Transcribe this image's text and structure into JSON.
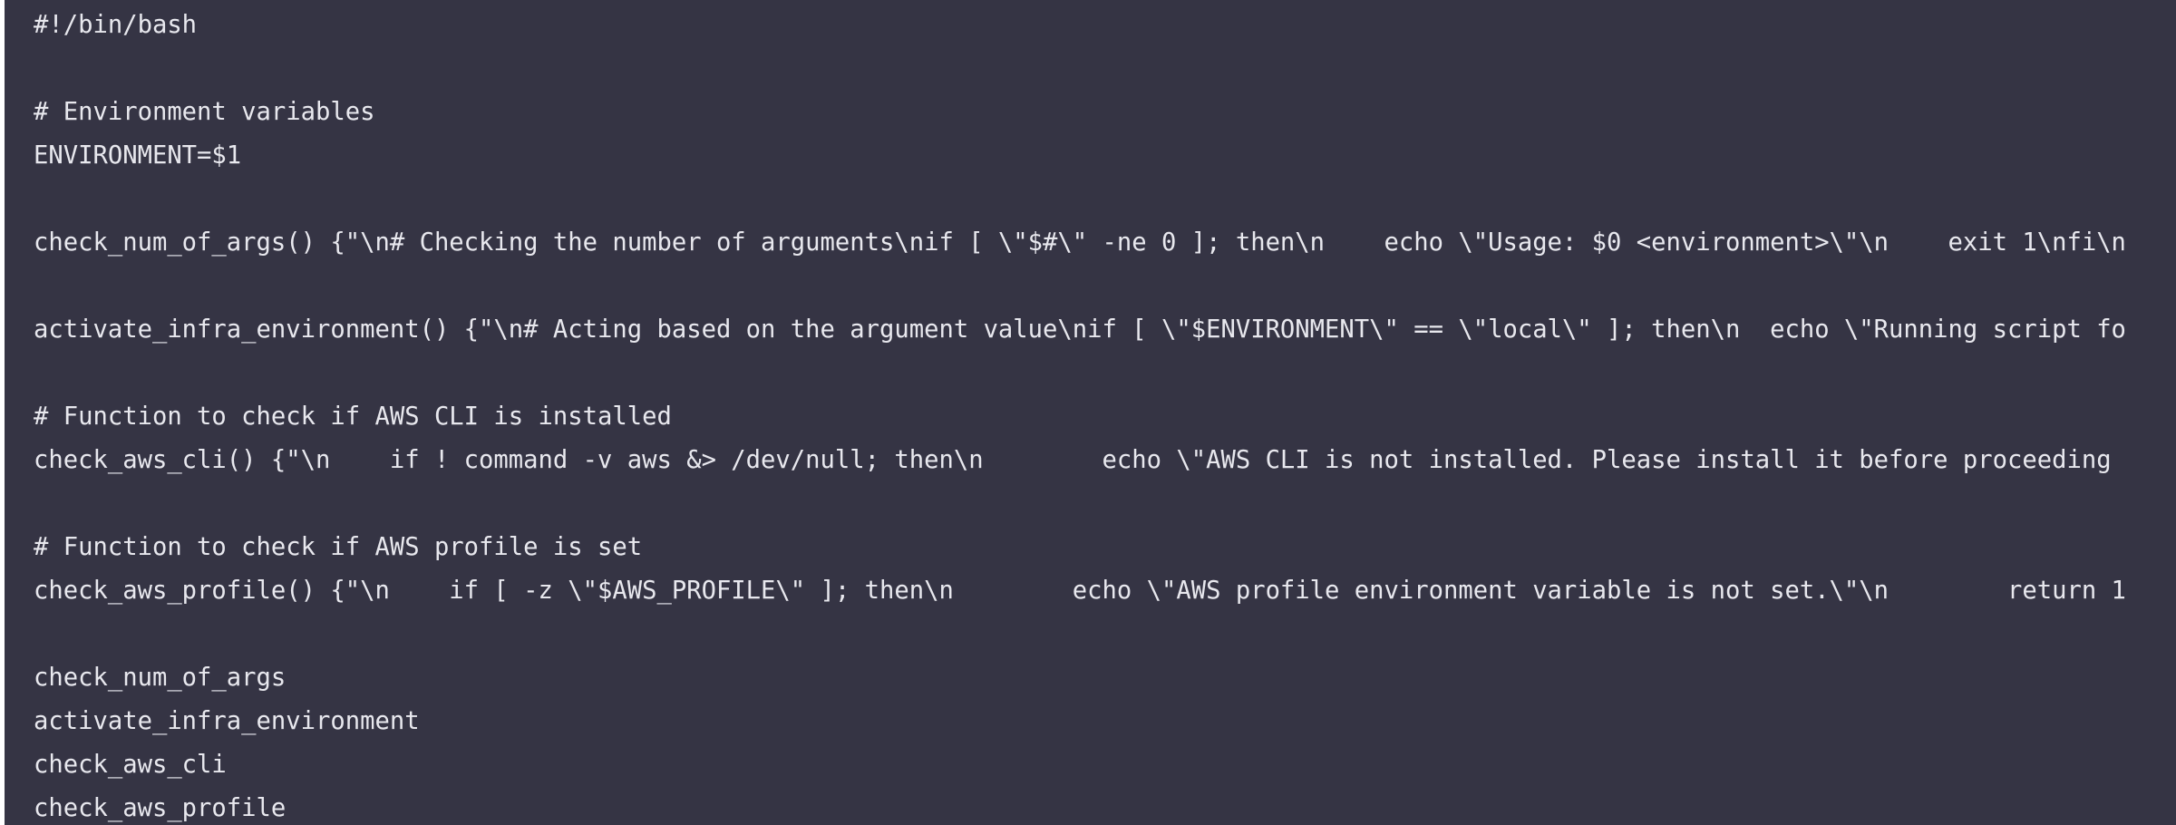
{
  "editor": {
    "background": "#353444",
    "text_color": "#e8e8ee",
    "lines": [
      "#!/bin/bash",
      "",
      "# Environment variables",
      "ENVIRONMENT=$1",
      "",
      "check_num_of_args() {\"\\n# Checking the number of arguments\\nif [ \\\"$#\\\" -ne 0 ]; then\\n    echo \\\"Usage: $0 <environment>\\\"\\n    exit 1\\nfi\\n",
      "",
      "activate_infra_environment() {\"\\n# Acting based on the argument value\\nif [ \\\"$ENVIRONMENT\\\" == \\\"local\\\" ]; then\\n  echo \\\"Running script fo",
      "",
      "# Function to check if AWS CLI is installed",
      "check_aws_cli() {\"\\n    if ! command -v aws &> /dev/null; then\\n        echo \\\"AWS CLI is not installed. Please install it before proceeding",
      "",
      "# Function to check if AWS profile is set",
      "check_aws_profile() {\"\\n    if [ -z \\\"$AWS_PROFILE\\\" ]; then\\n        echo \\\"AWS profile environment variable is not set.\\\"\\n        return 1",
      "",
      "check_num_of_args",
      "activate_infra_environment",
      "check_aws_cli",
      "check_aws_profile"
    ]
  }
}
